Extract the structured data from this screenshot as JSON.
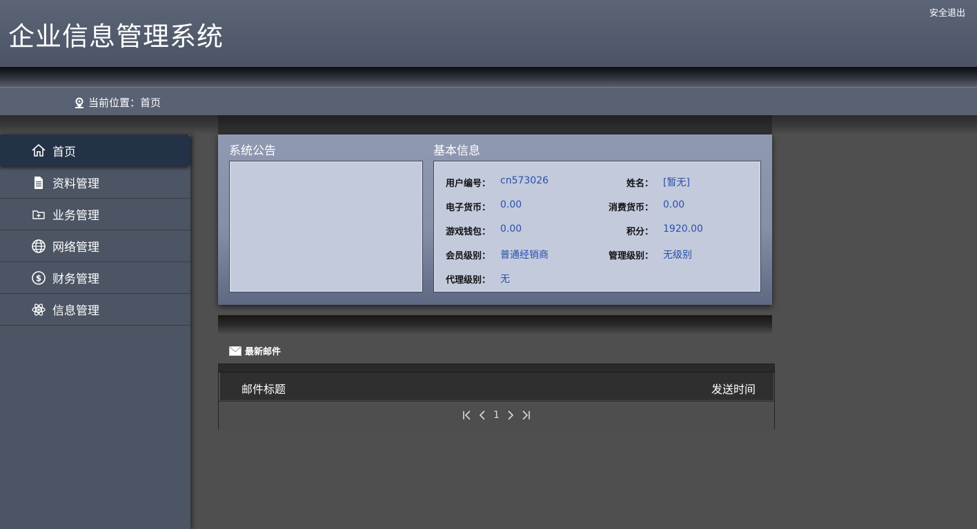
{
  "header": {
    "title": "企业信息管理系统",
    "logout_label": "安全退出"
  },
  "breadcrumb": {
    "text": "当前位置：首页"
  },
  "sidebar": {
    "items": [
      {
        "label": "首页",
        "icon": "home-icon",
        "active": true
      },
      {
        "label": "资料管理",
        "icon": "document-icon"
      },
      {
        "label": "业务管理",
        "icon": "folder-add-icon"
      },
      {
        "label": "网络管理",
        "icon": "globe-icon"
      },
      {
        "label": "财务管理",
        "icon": "dollar-circle-icon"
      },
      {
        "label": "信息管理",
        "icon": "atom-icon"
      }
    ]
  },
  "announcement": {
    "title": "系统公告"
  },
  "basic_info": {
    "title": "基本信息",
    "fields": {
      "user_id": {
        "label": "用户编号：",
        "value": "cn573026"
      },
      "name": {
        "label": "姓名：",
        "value": "[暂无]"
      },
      "e_currency": {
        "label": "电子货币：",
        "value": "0.00"
      },
      "consume_currency": {
        "label": "消费货币：",
        "value": "0.00"
      },
      "game_wallet": {
        "label": "游戏钱包：",
        "value": "0.00"
      },
      "points": {
        "label": "积分：",
        "value": "1920.00"
      },
      "member_level": {
        "label": "会员级别：",
        "value": "普通经销商"
      },
      "admin_level": {
        "label": "管理级别：",
        "value": "无级别"
      },
      "agent_level": {
        "label": "代理级别：",
        "value": "无"
      }
    }
  },
  "mail": {
    "heading": "最新邮件",
    "columns": {
      "title": "邮件标题",
      "time": "发送时间"
    },
    "pager": {
      "current_page": "1"
    }
  },
  "colors": {
    "header_bg": "#535c6e",
    "sidebar_bg": "#4c5564",
    "sidebar_active": "#243247",
    "panel_bg": "#8f99b1",
    "box_bg": "#c3cadc",
    "value_text": "#2a4fa8",
    "page_bg": "#4f4f4f"
  }
}
